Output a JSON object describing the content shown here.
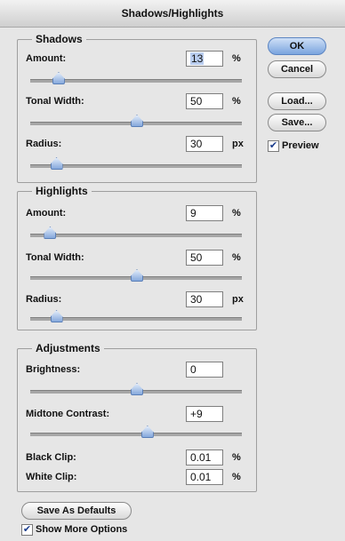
{
  "window": {
    "title": "Shadows/Highlights"
  },
  "shadows": {
    "legend": "Shadows",
    "amount": {
      "label": "Amount:",
      "value": "13",
      "unit": "%",
      "slider": 0.13
    },
    "tonal_width": {
      "label": "Tonal Width:",
      "value": "50",
      "unit": "%",
      "slider": 0.5
    },
    "radius": {
      "label": "Radius:",
      "value": "30",
      "unit": "px",
      "slider": 0.12
    }
  },
  "highlights": {
    "legend": "Highlights",
    "amount": {
      "label": "Amount:",
      "value": "9",
      "unit": "%",
      "slider": 0.09
    },
    "tonal_width": {
      "label": "Tonal Width:",
      "value": "50",
      "unit": "%",
      "slider": 0.5
    },
    "radius": {
      "label": "Radius:",
      "value": "30",
      "unit": "px",
      "slider": 0.12
    }
  },
  "adjustments": {
    "legend": "Adjustments",
    "brightness": {
      "label": "Brightness:",
      "value": "0",
      "slider": 0.5
    },
    "midtone_contrast": {
      "label": "Midtone Contrast:",
      "value": "+9",
      "slider": 0.55
    },
    "black_clip": {
      "label": "Black Clip:",
      "value": "0.01",
      "unit": "%"
    },
    "white_clip": {
      "label": "White Clip:",
      "value": "0.01",
      "unit": "%"
    }
  },
  "buttons": {
    "ok": "OK",
    "cancel": "Cancel",
    "load": "Load...",
    "save": "Save...",
    "save_defaults": "Save As Defaults"
  },
  "options": {
    "preview_label": "Preview",
    "preview_checked": true,
    "show_more_label": "Show More Options",
    "show_more_checked": true
  },
  "colors": {
    "accent": "#7aa4de",
    "check": "#1a3c8c"
  }
}
